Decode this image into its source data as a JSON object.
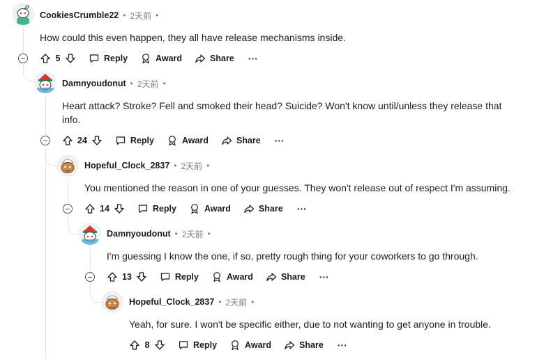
{
  "labels": {
    "reply": "Reply",
    "award": "Award",
    "share": "Share",
    "more": "···"
  },
  "colors": {
    "icon": "#1c1c1c",
    "muted": "#7c7c7c",
    "line": "#dfe3e6"
  },
  "comments": [
    {
      "author": "CookiesCrumble22",
      "time": "2天前",
      "text": "How could this even happen, they all have release mechanisms inside.",
      "score": "5"
    },
    {
      "author": "Damnyoudonut",
      "time": "2天前",
      "text": "Heart attack? Stroke? Fell and smoked their head? Suicide? Won't know until/unless they release that info.",
      "score": "24"
    },
    {
      "author": "Hopeful_Clock_2837",
      "time": "2天前",
      "text": "You mentioned the reason in one of your guesses. They won't release out of respect I'm assuming.",
      "score": "14"
    },
    {
      "author": "Damnyoudonut",
      "time": "2天前",
      "text": "I'm guessing I know the one, if so, pretty rough thing for your coworkers to go through.",
      "score": "13"
    },
    {
      "author": "Hopeful_Clock_2837",
      "time": "2天前",
      "text": "Yeah, for sure. I won't be specific either, due to not wanting to get anyone in trouble.",
      "score": "8"
    }
  ]
}
